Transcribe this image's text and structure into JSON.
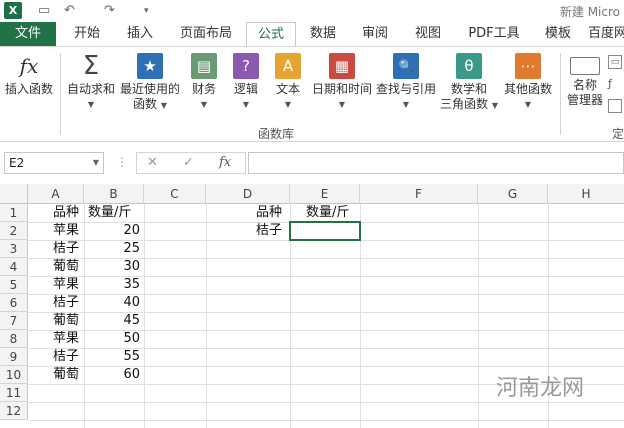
{
  "titlebar": {
    "app_icon": "X",
    "undo": "↶",
    "redo": "↷",
    "doc_title": "新建 Micro"
  },
  "tabs": [
    "文件",
    "开始",
    "插入",
    "页面布局",
    "公式",
    "数据",
    "审阅",
    "视图",
    "PDF工具",
    "模板",
    "百度网"
  ],
  "ribbon": {
    "insert_fn": "插入函数",
    "autosum": "自动求和",
    "recent_1": "最近使用的",
    "recent_2": "函数",
    "finance": "财务",
    "logic": "逻辑",
    "text": "文本",
    "datetime": "日期和时间",
    "lookup": "查找与引用",
    "math_1": "数学和",
    "math_2": "三角函数",
    "other": "其他函数",
    "name_1": "名称",
    "name_2": "管理器",
    "group_label": "函数库",
    "group_label_2": "定",
    "icons": {
      "fx": "fx",
      "sigma": "Σ",
      "star": "★",
      "finance": "▤",
      "logic": "?",
      "text": "A",
      "datetime": "▦",
      "lookup": "🔍",
      "theta": "θ",
      "other": "⋯"
    }
  },
  "formula_bar": {
    "name_box": "E2",
    "cancel": "✕",
    "enter": "✓",
    "fx": "fx",
    "value": ""
  },
  "columns": [
    "A",
    "B",
    "C",
    "D",
    "E",
    "F",
    "G",
    "H"
  ],
  "rows": [
    "1",
    "2",
    "3",
    "4",
    "5",
    "6",
    "7",
    "8",
    "9",
    "10",
    "11",
    "12"
  ],
  "cells": {
    "A": [
      "品种",
      "苹果",
      "桔子",
      "葡萄",
      "苹果",
      "桔子",
      "葡萄",
      "苹果",
      "桔子",
      "葡萄"
    ],
    "B": [
      "数量/斤",
      "20",
      "25",
      "30",
      "35",
      "40",
      "45",
      "50",
      "55",
      "60"
    ],
    "D": [
      "品种",
      "桔子"
    ],
    "E": [
      "数量/斤",
      ""
    ]
  },
  "watermark": "河南龙网",
  "colors": {
    "accent": "#217346"
  }
}
